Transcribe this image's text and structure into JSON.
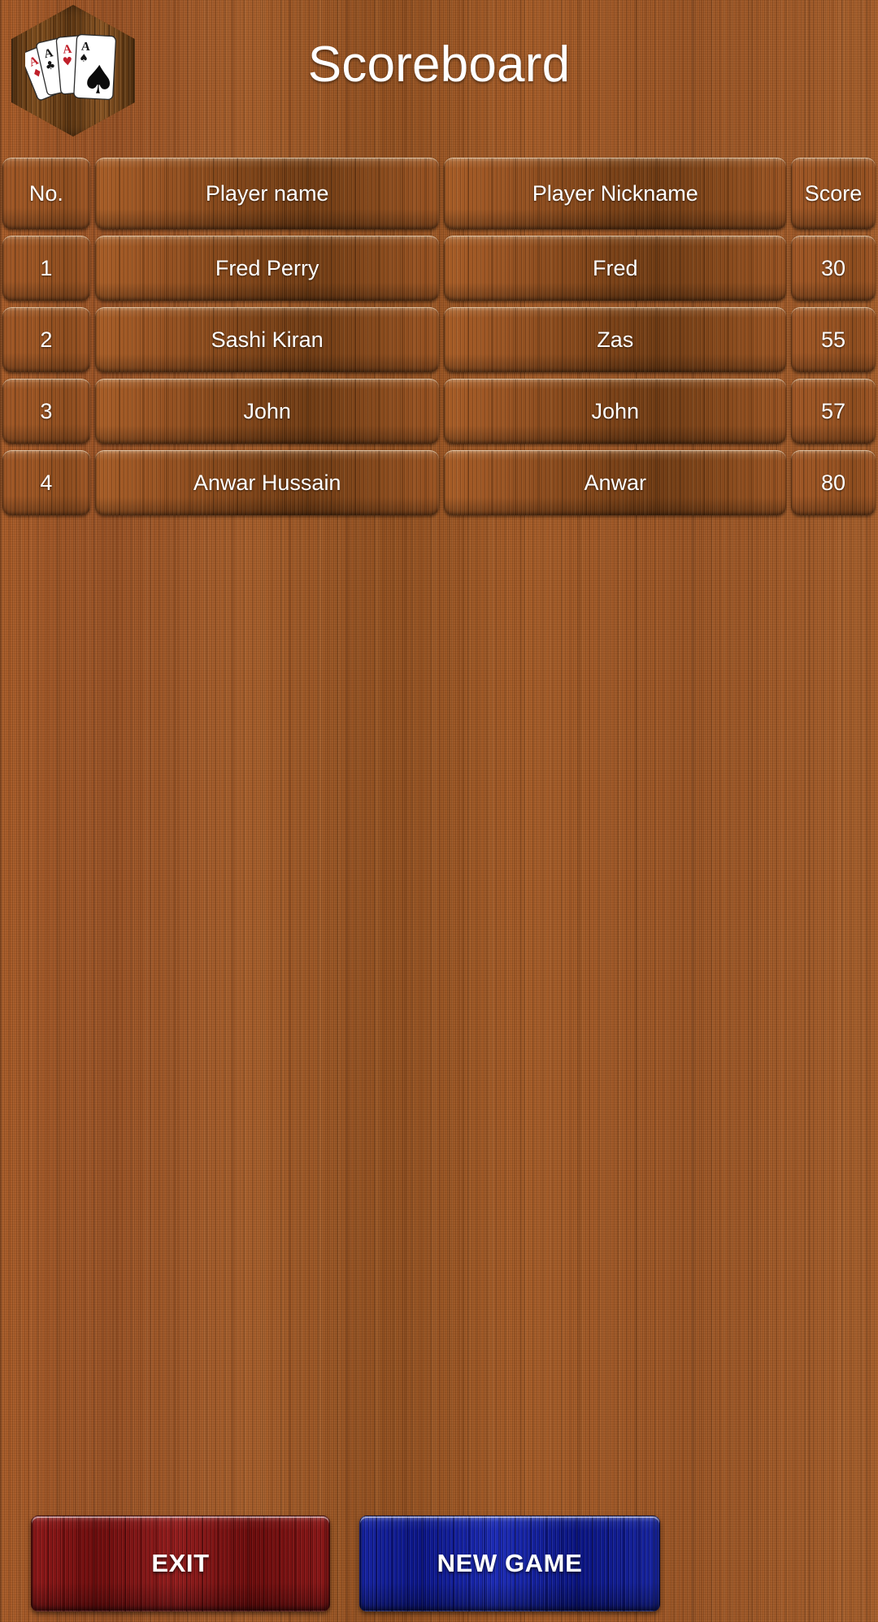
{
  "app": {
    "logo_icon": "four-aces-hexagon-icon",
    "logo_cards": [
      {
        "rank": "A",
        "suit": "diamond",
        "suit_glyph": "♦",
        "color": "#c0202a"
      },
      {
        "rank": "A",
        "suit": "club",
        "suit_glyph": "♣",
        "color": "#111111"
      },
      {
        "rank": "A",
        "suit": "heart",
        "suit_glyph": "♥",
        "color": "#c0202a"
      },
      {
        "rank": "A",
        "suit": "spade",
        "suit_glyph": "♠",
        "color": "#111111"
      }
    ]
  },
  "header": {
    "title": "Scoreboard"
  },
  "table": {
    "columns": [
      "No.",
      "Player name",
      "Player Nickname",
      "Score"
    ],
    "rows": [
      {
        "no": "1",
        "name": "Fred Perry",
        "nickname": "Fred",
        "score": "30"
      },
      {
        "no": "2",
        "name": "Sashi Kiran",
        "nickname": "Zas",
        "score": "55"
      },
      {
        "no": "3",
        "name": "John",
        "nickname": "John",
        "score": "57"
      },
      {
        "no": "4",
        "name": "Anwar Hussain",
        "nickname": "Anwar",
        "score": "80"
      }
    ]
  },
  "actions": {
    "exit_label": "EXIT",
    "new_game_label": "NEW GAME"
  },
  "colors": {
    "background_wood": "#9d5526",
    "cell_wood": "#8e4d1f",
    "exit_red": "#7d1212",
    "new_game_blue": "#0f1d9a",
    "text": "#ffffff"
  }
}
